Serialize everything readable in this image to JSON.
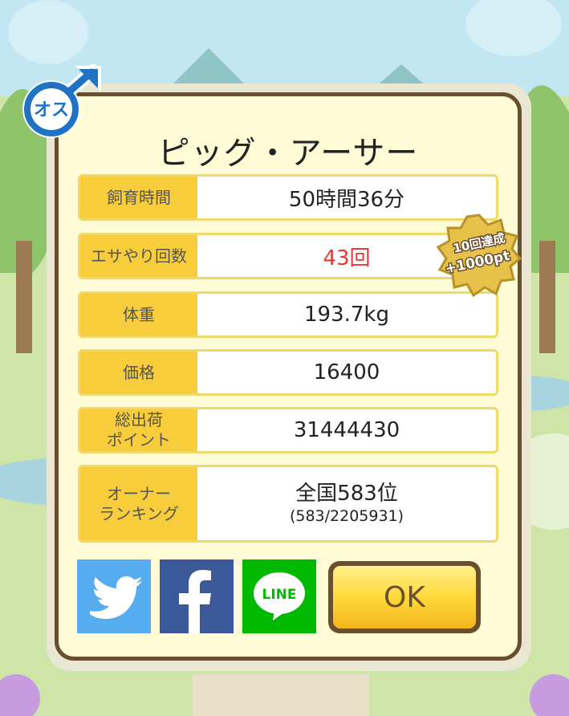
{
  "pig_name": "ピッグ・アーサー",
  "gender_label": "オス",
  "stats": [
    {
      "label": "飼育時間",
      "value": "50時間36分"
    },
    {
      "label": "エサやり回数",
      "value": "43回"
    },
    {
      "label": "体重",
      "value": "193.7kg"
    },
    {
      "label": "価格",
      "value": "16400"
    },
    {
      "label": "総出荷\nポイント",
      "value": "31444430"
    }
  ],
  "ranking": {
    "label": "オーナー\nランキング",
    "main": "全国583位",
    "sub": "(583/2205931)"
  },
  "bonus_badge": {
    "line1": "10回達成",
    "line2": "+1000pt"
  },
  "share": {
    "line_label": "LINE"
  },
  "ok_label": "OK",
  "colors": {
    "card_bg": "#fffbd6",
    "label_bg": "#f7cd3b",
    "border": "#6a4f2e",
    "highlight": "#e53935",
    "twitter": "#55acee",
    "facebook": "#3b5998",
    "line": "#00b900"
  }
}
